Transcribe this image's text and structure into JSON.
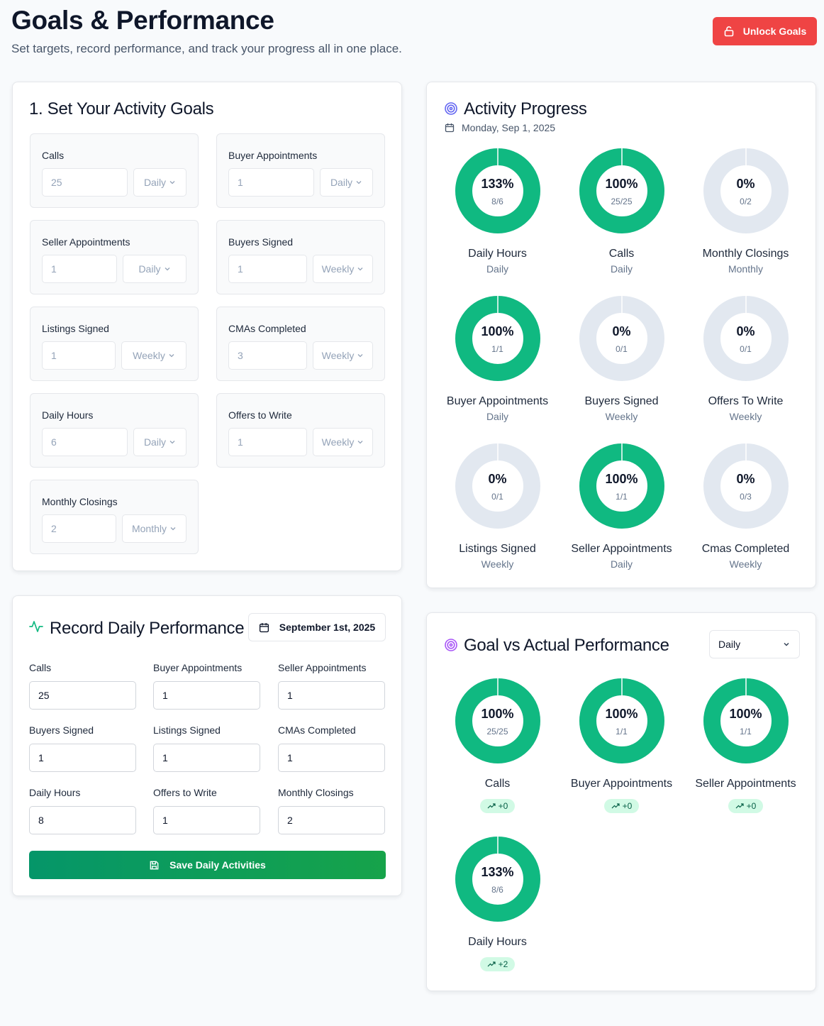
{
  "header": {
    "title": "Goals & Performance",
    "subtitle": "Set targets, record performance, and track your progress all in one place.",
    "unlock_label": "Unlock Goals"
  },
  "goals": {
    "title": "1. Set Your Activity Goals",
    "items": [
      {
        "label": "Calls",
        "value": "25",
        "period": "Daily"
      },
      {
        "label": "Buyer Appointments",
        "value": "1",
        "period": "Daily"
      },
      {
        "label": "Seller Appointments",
        "value": "1",
        "period": "Daily"
      },
      {
        "label": "Buyers Signed",
        "value": "1",
        "period": "Weekly"
      },
      {
        "label": "Listings Signed",
        "value": "1",
        "period": "Weekly"
      },
      {
        "label": "CMAs Completed",
        "value": "3",
        "period": "Weekly"
      },
      {
        "label": "Daily Hours",
        "value": "6",
        "period": "Daily"
      },
      {
        "label": "Offers to Write",
        "value": "1",
        "period": "Weekly"
      },
      {
        "label": "Monthly Closings",
        "value": "2",
        "period": "Monthly"
      }
    ]
  },
  "progress": {
    "title": "Activity Progress",
    "date": "Monday, Sep 1, 2025",
    "items": [
      {
        "name": "Daily Hours",
        "period": "Daily",
        "pct_label": "133%",
        "frac": "8/6",
        "fill": 1.0
      },
      {
        "name": "Calls",
        "period": "Daily",
        "pct_label": "100%",
        "frac": "25/25",
        "fill": 1.0
      },
      {
        "name": "Monthly Closings",
        "period": "Monthly",
        "pct_label": "0%",
        "frac": "0/2",
        "fill": 0
      },
      {
        "name": "Buyer Appointments",
        "period": "Daily",
        "pct_label": "100%",
        "frac": "1/1",
        "fill": 1.0
      },
      {
        "name": "Buyers Signed",
        "period": "Weekly",
        "pct_label": "0%",
        "frac": "0/1",
        "fill": 0
      },
      {
        "name": "Offers To Write",
        "period": "Weekly",
        "pct_label": "0%",
        "frac": "0/1",
        "fill": 0
      },
      {
        "name": "Listings Signed",
        "period": "Weekly",
        "pct_label": "0%",
        "frac": "0/1",
        "fill": 0
      },
      {
        "name": "Seller Appointments",
        "period": "Daily",
        "pct_label": "100%",
        "frac": "1/1",
        "fill": 1.0
      },
      {
        "name": "Cmas Completed",
        "period": "Weekly",
        "pct_label": "0%",
        "frac": "0/3",
        "fill": 0
      }
    ]
  },
  "record": {
    "title": "Record Daily Performance",
    "date_label": "September 1st, 2025",
    "fields": [
      {
        "label": "Calls",
        "value": "25"
      },
      {
        "label": "Buyer Appointments",
        "value": "1"
      },
      {
        "label": "Seller Appointments",
        "value": "1"
      },
      {
        "label": "Buyers Signed",
        "value": "1"
      },
      {
        "label": "Listings Signed",
        "value": "1"
      },
      {
        "label": "CMAs Completed",
        "value": "1"
      },
      {
        "label": "Daily Hours",
        "value": "8"
      },
      {
        "label": "Offers to Write",
        "value": "1"
      },
      {
        "label": "Monthly Closings",
        "value": "2"
      }
    ],
    "save_label": "Save Daily Activities"
  },
  "gva": {
    "title": "Goal vs Actual Performance",
    "period_select": "Daily",
    "items": [
      {
        "name": "Calls",
        "pct_label": "100%",
        "frac": "25/25",
        "delta": "+0",
        "fill": 1.0
      },
      {
        "name": "Buyer Appointments",
        "pct_label": "100%",
        "frac": "1/1",
        "delta": "+0",
        "fill": 1.0
      },
      {
        "name": "Seller Appointments",
        "pct_label": "100%",
        "frac": "1/1",
        "delta": "+0",
        "fill": 1.0
      },
      {
        "name": "Daily Hours",
        "pct_label": "133%",
        "frac": "8/6",
        "delta": "+2",
        "fill": 1.0
      }
    ]
  },
  "colors": {
    "accent_green": "#10b981",
    "track_gray": "#e2e8f0",
    "danger_red": "#ef4444",
    "brand_purple": "#6366f1"
  }
}
